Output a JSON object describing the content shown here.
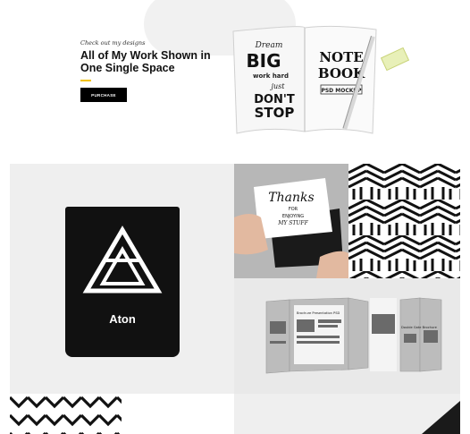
{
  "hero": {
    "kicker": "Check out my designs",
    "headline": "All of My Work Shown in One Single Space",
    "cta_label": "PURCHASE"
  },
  "notebook": {
    "left_page": [
      "Dream",
      "BIG",
      "work hard",
      "just",
      "DON'T",
      "STOP"
    ],
    "right_page": [
      "NOTE",
      "BOOK",
      "PSD MOCKUP"
    ]
  },
  "portfolio": {
    "bag_brand": "Aton",
    "card_text": [
      "Thanks",
      "FOR",
      "ENJOYING",
      "MY STUFF"
    ]
  },
  "brochure": {
    "heading_left": "Brochure Presentation PSD",
    "heading_right": "Double Gate Brochure"
  },
  "colors": {
    "accent": "#f3c200",
    "button": "#000000",
    "tile_gray": "#efefef"
  }
}
